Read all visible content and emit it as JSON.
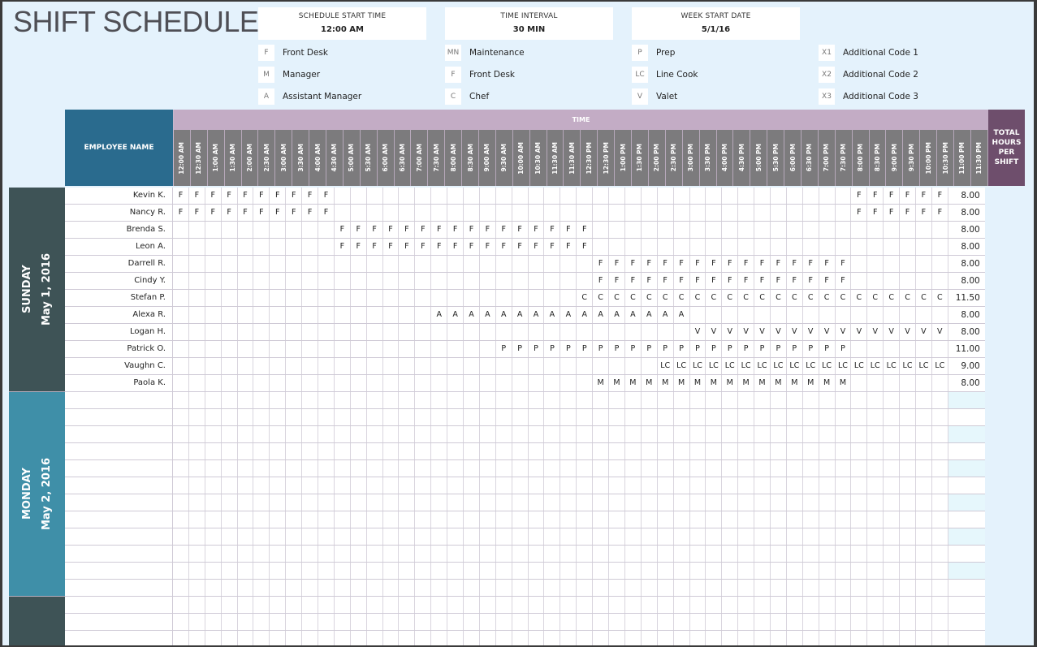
{
  "title": "SHIFT SCHEDULE",
  "info": [
    {
      "label": "SCHEDULE START TIME",
      "value": "12:00 AM"
    },
    {
      "label": "TIME INTERVAL",
      "value": "30 MIN"
    },
    {
      "label": "WEEK START DATE",
      "value": "5/1/16"
    }
  ],
  "legend": [
    [
      {
        "code": "F",
        "label": "Front Desk"
      },
      {
        "code": "M",
        "label": "Manager"
      },
      {
        "code": "A",
        "label": "Assistant Manager"
      }
    ],
    [
      {
        "code": "MN",
        "label": "Maintenance"
      },
      {
        "code": "F",
        "label": "Front Desk"
      },
      {
        "code": "C",
        "label": "Chef"
      }
    ],
    [
      {
        "code": "P",
        "label": "Prep"
      },
      {
        "code": "LC",
        "label": "Line Cook"
      },
      {
        "code": "V",
        "label": "Valet"
      }
    ],
    [
      {
        "code": "X1",
        "label": "Additional Code 1"
      },
      {
        "code": "X2",
        "label": "Additional Code 2"
      },
      {
        "code": "X3",
        "label": "Additional Code 3"
      }
    ]
  ],
  "header": {
    "employee_name": "EMPLOYEE NAME",
    "time": "TIME",
    "total": "TOTAL HOURS PER SHIFT",
    "time_slots": [
      "12:00 AM",
      "12:30 AM",
      "1:00 AM",
      "1:30 AM",
      "2:00 AM",
      "2:30 AM",
      "3:00 AM",
      "3:30 AM",
      "4:00 AM",
      "4:30 AM",
      "5:00 AM",
      "5:30 AM",
      "6:00 AM",
      "6:30 AM",
      "7:00 AM",
      "7:30 AM",
      "8:00 AM",
      "8:30 AM",
      "9:00 AM",
      "9:30 AM",
      "10:00 AM",
      "10:30 AM",
      "11:30 AM",
      "11:30 AM",
      "12:30 PM",
      "12:30 PM",
      "1:00 PM",
      "1:30 PM",
      "2:00 PM",
      "2:30 PM",
      "3:00 PM",
      "3:30 PM",
      "4:00 PM",
      "4:30 PM",
      "5:00 PM",
      "5:30 PM",
      "6:00 PM",
      "6:30 PM",
      "7:00 PM",
      "7:30 PM",
      "8:00 PM",
      "8:30 PM",
      "9:00 PM",
      "9:30 PM",
      "10:00 PM",
      "10:30 PM",
      "11:00 PM",
      "11:30 PM"
    ]
  },
  "days": [
    {
      "day": "SUNDAY",
      "date": "May 1, 2016",
      "color": "#3e5356",
      "employees": [
        {
          "name": "Kevin K.",
          "code": "F",
          "slots": [
            [
              0,
              9
            ],
            [
              42,
              47
            ]
          ],
          "total": "8.00"
        },
        {
          "name": "Nancy R.",
          "code": "F",
          "slots": [
            [
              0,
              9
            ],
            [
              42,
              47
            ]
          ],
          "total": "8.00"
        },
        {
          "name": "Brenda S.",
          "code": "F",
          "slots": [
            [
              10,
              25
            ]
          ],
          "total": "8.00"
        },
        {
          "name": "Leon A.",
          "code": "F",
          "slots": [
            [
              10,
              25
            ]
          ],
          "total": "8.00"
        },
        {
          "name": "Darrell R.",
          "code": "F",
          "slots": [
            [
              26,
              41
            ]
          ],
          "total": "8.00"
        },
        {
          "name": "Cindy Y.",
          "code": "F",
          "slots": [
            [
              26,
              41
            ]
          ],
          "total": "8.00"
        },
        {
          "name": "Stefan P.",
          "code": "C",
          "slots": [
            [
              25,
              47
            ]
          ],
          "total": "11.50"
        },
        {
          "name": "Alexa R.",
          "code": "A",
          "slots": [
            [
              16,
              31
            ]
          ],
          "total": "8.00"
        },
        {
          "name": "Logan H.",
          "code": "V",
          "slots": [
            [
              32,
              47
            ]
          ],
          "total": "8.00"
        },
        {
          "name": "Patrick O.",
          "code": "P",
          "slots": [
            [
              20,
              41
            ]
          ],
          "total": "11.00"
        },
        {
          "name": "Vaughn C.",
          "code": "LC",
          "slots": [
            [
              30,
              47
            ]
          ],
          "total": "9.00"
        },
        {
          "name": "Paola K.",
          "code": "M",
          "slots": [
            [
              26,
              41
            ]
          ],
          "total": "8.00"
        }
      ]
    },
    {
      "day": "MONDAY",
      "date": "May 2, 2016",
      "color": "#3f8fa8",
      "employees": [
        {
          "name": "",
          "code": "",
          "slots": [],
          "total": ""
        },
        {
          "name": "",
          "code": "",
          "slots": [],
          "total": ""
        },
        {
          "name": "",
          "code": "",
          "slots": [],
          "total": ""
        },
        {
          "name": "",
          "code": "",
          "slots": [],
          "total": ""
        },
        {
          "name": "",
          "code": "",
          "slots": [],
          "total": ""
        },
        {
          "name": "",
          "code": "",
          "slots": [],
          "total": ""
        },
        {
          "name": "",
          "code": "",
          "slots": [],
          "total": ""
        },
        {
          "name": "",
          "code": "",
          "slots": [],
          "total": ""
        },
        {
          "name": "",
          "code": "",
          "slots": [],
          "total": ""
        },
        {
          "name": "",
          "code": "",
          "slots": [],
          "total": ""
        },
        {
          "name": "",
          "code": "",
          "slots": [],
          "total": ""
        },
        {
          "name": "",
          "code": "",
          "slots": [],
          "total": ""
        }
      ]
    },
    {
      "day": "",
      "date": "",
      "color": "#3e5356",
      "employees": [
        {
          "name": "",
          "code": "",
          "slots": [],
          "total": ""
        },
        {
          "name": "",
          "code": "",
          "slots": [],
          "total": ""
        },
        {
          "name": "",
          "code": "",
          "slots": [],
          "total": ""
        }
      ]
    }
  ]
}
